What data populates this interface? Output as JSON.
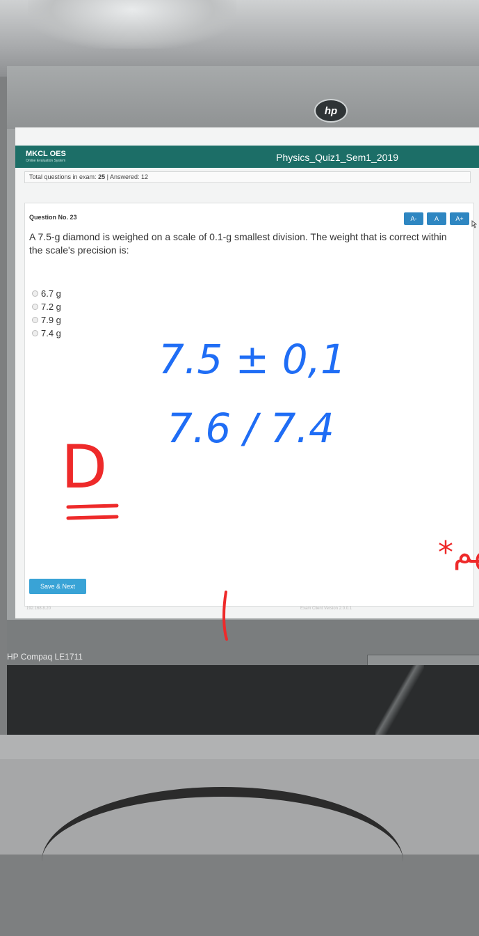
{
  "bezel": {
    "brand_logo": "hp",
    "model": "HP Compaq LE1711"
  },
  "app": {
    "brand": "MKCL OES",
    "brand_subtitle": "Online Evaluation System",
    "exam_title": "Physics_Quiz1_Sem1_2019"
  },
  "info": {
    "total_label": "Total questions in exam:",
    "total_value": "25",
    "separator": "|",
    "answered_label": "Answered:",
    "answered_value": "12"
  },
  "question": {
    "number_label": "Question No. 23",
    "text": "A 7.5-g diamond is weighed on a scale of 0.1-g smallest division. The weight that is correct within the scale's precision is:",
    "options": [
      {
        "label": "6.7 g"
      },
      {
        "label": "7.2 g"
      },
      {
        "label": "7.9 g"
      },
      {
        "label": "7.4 g"
      }
    ]
  },
  "font_buttons": [
    "A-",
    "A",
    "A+"
  ],
  "actions": {
    "save_next": "Save & Next"
  },
  "footer": {
    "ip": "192.168.8.20",
    "version": "Exam Client Version 2.0.0.1"
  },
  "annotations": {
    "line1": "7.5 ± 0,1",
    "line2": "7.6 / 7.4",
    "answer": "D",
    "arabic": "واحد منهم يجيهم*"
  },
  "colors": {
    "header": "#1c6e67",
    "button": "#2e86c1",
    "save": "#39a3d6",
    "ink_blue": "#1f6df5",
    "ink_red": "#ee2a2a"
  }
}
